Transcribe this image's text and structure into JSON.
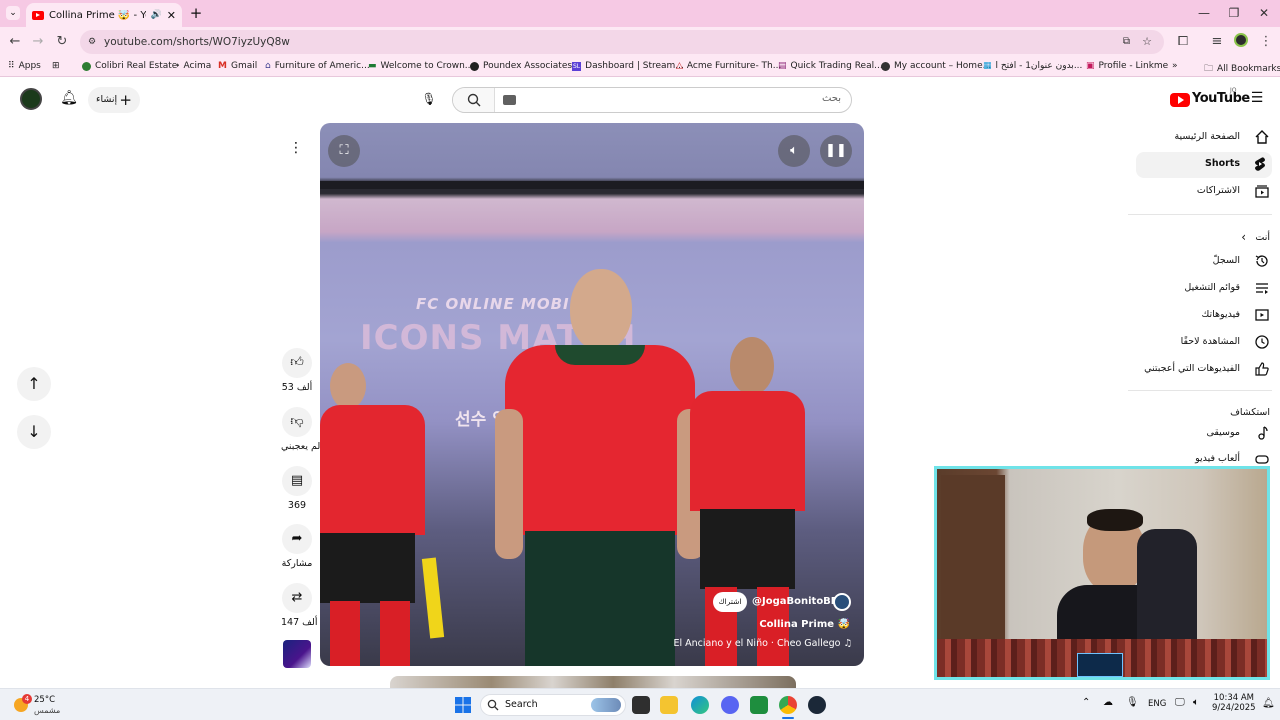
{
  "browser": {
    "tab_title": "Collina Prime 🤯 - YouTube",
    "new_tab": "+",
    "url": "youtube.com/shorts/WO7iyzUyQ8w",
    "bookmarks": [
      {
        "label": "Apps",
        "color": "#4285f4"
      },
      {
        "label": "Colibri Real Estate",
        "color": "#2e7d32"
      },
      {
        "label": "Acima",
        "color": "#333333"
      },
      {
        "label": "Gmail",
        "color": "#d93025"
      },
      {
        "label": "Furniture of Americ...",
        "color": "#3b3b8f"
      },
      {
        "label": "Welcome to Crown...",
        "color": "#1e7b34"
      },
      {
        "label": "Poundex Associates...",
        "color": "#222222"
      },
      {
        "label": "Dashboard | Stream...",
        "color": "#5b3fd6"
      },
      {
        "label": "Acme Furniture- Th...",
        "color": "#c62828"
      },
      {
        "label": "Quick Trading Real...",
        "color": "#8e2a7a"
      },
      {
        "label": "My account – Home...",
        "color": "#333333"
      },
      {
        "label": "بدون عنوان1 - افتح ا...",
        "color": "#1ba0d8"
      },
      {
        "label": "Profile - Linkme",
        "color": "#c2185b"
      }
    ],
    "all_bookmarks": "All Bookmarks"
  },
  "youtube": {
    "logo_text": "YouTube",
    "logo_region": "JO",
    "search_placeholder": "بحث",
    "create_label": "إنشاء",
    "sidebar": [
      {
        "label": "الصفحة الرئيسية",
        "icon": "home-icon"
      },
      {
        "label": "Shorts",
        "icon": "shorts-icon"
      },
      {
        "label": "الاشتراكات",
        "icon": "subscriptions-icon"
      }
    ],
    "you_heading": "أنت",
    "you_items": [
      {
        "label": "السجلّ",
        "icon": "history-icon"
      },
      {
        "label": "قوائم التشغيل",
        "icon": "playlists-icon"
      },
      {
        "label": "فيديوهاتك",
        "icon": "your-videos-icon"
      },
      {
        "label": "المشاهدة لاحقًا",
        "icon": "watch-later-icon"
      },
      {
        "label": "الفيديوهات التي أعجبتني",
        "icon": "liked-videos-icon"
      }
    ],
    "explore_heading": "استكشاف",
    "explore_items": [
      {
        "label": "موسيقى",
        "icon": "music-icon"
      },
      {
        "label": "ألعاب فيديو",
        "icon": "gaming-icon"
      }
    ]
  },
  "short": {
    "channel": "@JogaBonitoBR1",
    "subscribe": "اشتراك",
    "title": "Collina Prime 🤯",
    "music": "El Anciano y el Niño · Cheo Gallego",
    "likes": "53 ألف",
    "dislike_label": "لم يعجبني",
    "comments": "369",
    "share_label": "مشاركة",
    "remix": "147 ألف",
    "banner_text": "ICONS MATCH",
    "banner_brand": "FC ONLINE   MOBILE",
    "banner_korean": "선수 입"
  },
  "taskbar": {
    "weather_temp": "25°C",
    "weather_desc": "مشمس",
    "weather_badge": "4",
    "search_label": "Search",
    "lang": "ENG",
    "time": "10:34 AM",
    "date": "9/24/2025"
  }
}
